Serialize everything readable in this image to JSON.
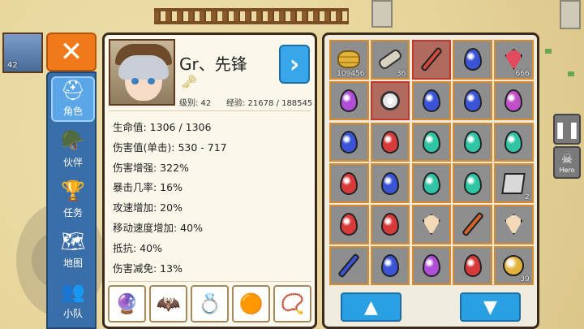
{
  "hero_thumb": {
    "level": "42"
  },
  "close_label": "✕",
  "tabs": [
    {
      "label": "角色",
      "icon": "knight-helmet-icon",
      "glyph": "⛑"
    },
    {
      "label": "伙伴",
      "icon": "viking-helmet-icon",
      "glyph": "🪖"
    },
    {
      "label": "任务",
      "icon": "trophy-icon",
      "glyph": "🏆"
    },
    {
      "label": "地图",
      "icon": "map-icon",
      "glyph": "🗺"
    },
    {
      "label": "小队",
      "icon": "party-icon",
      "glyph": "👥"
    }
  ],
  "character": {
    "name": "Gr、先锋",
    "level_text": "级别: 42",
    "exp_text": "经验: 21678 / 188545",
    "next_label": "›",
    "stats": [
      "生命值: 1306 / 1306",
      "伤害值(单击): 530 - 717",
      "伤害增强: 322%",
      "暴击几率: 16%",
      "攻速增加: 20%",
      "移动速度增加: 40%",
      "抵抗: 40%",
      "伤害减免: 13%"
    ],
    "equipment": [
      {
        "icon": "staff-icon",
        "glyph": "🔮"
      },
      {
        "icon": "armor-icon",
        "glyph": "🦇"
      },
      {
        "icon": "ring-icon",
        "glyph": "💍"
      },
      {
        "icon": "bracelet-icon",
        "glyph": "🟠"
      },
      {
        "icon": "amulet-icon",
        "glyph": "📿"
      }
    ]
  },
  "inventory": {
    "cells": [
      {
        "kind": "coins",
        "color": "#e2b33a",
        "qty": "109456"
      },
      {
        "kind": "scroll",
        "color": "#d8d2c0",
        "qty": "36"
      },
      {
        "kind": "staff",
        "color": "#d14b3b",
        "qty": "",
        "selected": true
      },
      {
        "kind": "gem",
        "color": "#3b54d6",
        "qty": ""
      },
      {
        "kind": "crystal",
        "color": "#e24a5d",
        "qty": "666"
      },
      {
        "kind": "gem",
        "color": "#b04fd6",
        "qty": ""
      },
      {
        "kind": "amulet",
        "color": "#e8e8e8",
        "qty": "",
        "selected": true
      },
      {
        "kind": "gem",
        "color": "#3b54d6",
        "qty": ""
      },
      {
        "kind": "gem",
        "color": "#3b54d6",
        "qty": ""
      },
      {
        "kind": "gem",
        "color": "#c04fc8",
        "qty": ""
      },
      {
        "kind": "gem",
        "color": "#3b54d6",
        "qty": ""
      },
      {
        "kind": "gem",
        "color": "#d83a3a",
        "qty": ""
      },
      {
        "kind": "gem",
        "color": "#2fc4a4",
        "qty": ""
      },
      {
        "kind": "gem",
        "color": "#2fc4a4",
        "qty": ""
      },
      {
        "kind": "gem",
        "color": "#2fc4a4",
        "qty": ""
      },
      {
        "kind": "gem",
        "color": "#d83a3a",
        "qty": ""
      },
      {
        "kind": "gem",
        "color": "#3b54d6",
        "qty": ""
      },
      {
        "kind": "gem",
        "color": "#2fc4a4",
        "qty": ""
      },
      {
        "kind": "gem",
        "color": "#2fc4a4",
        "qty": ""
      },
      {
        "kind": "stone",
        "color": "#d9d9d9",
        "qty": "2"
      },
      {
        "kind": "gem",
        "color": "#d83a3a",
        "qty": ""
      },
      {
        "kind": "gem",
        "color": "#d83a3a",
        "qty": ""
      },
      {
        "kind": "diamond",
        "color": "#f4d9b8",
        "qty": ""
      },
      {
        "kind": "sword",
        "color": "#d4622a",
        "qty": ""
      },
      {
        "kind": "diamond",
        "color": "#f4d9b8",
        "qty": ""
      },
      {
        "kind": "wand",
        "color": "#3b54d6",
        "qty": ""
      },
      {
        "kind": "gem",
        "color": "#3b54d6",
        "qty": ""
      },
      {
        "kind": "gem",
        "color": "#b04fd6",
        "qty": ""
      },
      {
        "kind": "gem",
        "color": "#d83a3a",
        "qty": ""
      },
      {
        "kind": "orb",
        "color": "#e2b33a",
        "qty": "39"
      }
    ],
    "up_label": "▲",
    "down_label": "▼"
  },
  "hud": {
    "pause_label": "❚❚",
    "hero_label": "Hero"
  }
}
